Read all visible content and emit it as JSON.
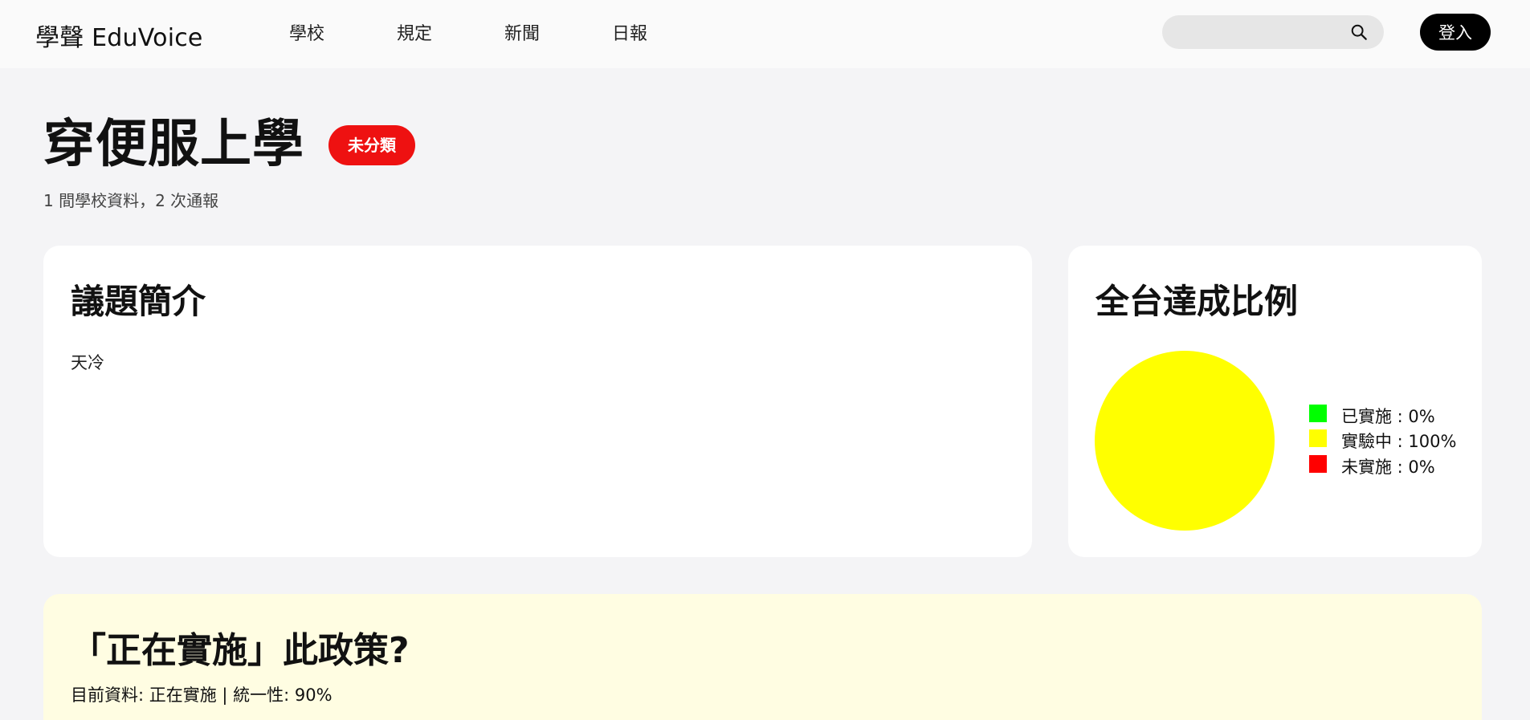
{
  "header": {
    "brand": "學聲 EduVoice",
    "nav": [
      "學校",
      "規定",
      "新聞",
      "日報"
    ],
    "search_placeholder": "",
    "login_label": "登入"
  },
  "topic": {
    "title": "穿便服上學",
    "category": "未分類",
    "summary": "1 間學校資料，2 次通報"
  },
  "intro_card": {
    "heading": "議題簡介",
    "text": "天冷"
  },
  "stats_card": {
    "heading": "全台達成比例",
    "legend": [
      {
        "label": "已實施 : 0%",
        "color": "#00ff00",
        "value": 0
      },
      {
        "label": "實驗中 : 100%",
        "color": "#ffff00",
        "value": 100
      },
      {
        "label": "未實施 : 0%",
        "color": "#ff0000",
        "value": 0
      }
    ]
  },
  "policy_card": {
    "heading": "「正在實施」此政策?",
    "status": "目前資料: 正在實施 | 統一性: 90%"
  },
  "colors": {
    "badge": "#ee1111",
    "policy_bg": "#fffde2",
    "login_bg": "#000000"
  }
}
